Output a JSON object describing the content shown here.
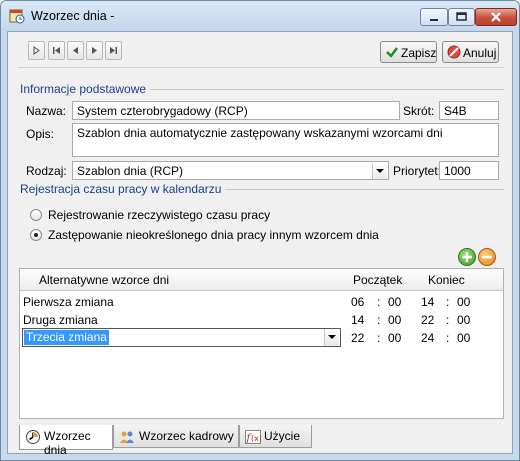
{
  "window": {
    "title": "Wzorzec dnia -"
  },
  "toolbar": {
    "save_label": "Zapisz",
    "cancel_label": "Anuluj"
  },
  "basic": {
    "section_title": "Informacje podstawowe",
    "name_label": "Nazwa:",
    "name_value": "System czterobrygadowy (RCP)",
    "short_label": "Skrót:",
    "short_value": "S4B",
    "desc_label": "Opis:",
    "desc_value": "Szablon dnia automatycznie zastępowany wskazanymi wzorcami dni",
    "type_label": "Rodzaj:",
    "type_value": "Szablon dnia (RCP)",
    "priority_label": "Priorytet:",
    "priority_value": "1000"
  },
  "registration": {
    "section_title": "Rejestracja czasu pracy w kalendarzu",
    "option1": "Rejestrowanie rzeczywistego czasu pracy",
    "option2": "Zastępowanie nieokreślonego dnia pracy innym wzorcem dnia",
    "selected": 2
  },
  "grid": {
    "col_name": "Alternatywne wzorce dni",
    "col_start": "Początek",
    "col_end": "Koniec",
    "rows": [
      {
        "name": "Pierwsza zmiana",
        "sh": "06",
        "sm": "00",
        "eh": "14",
        "em": "00"
      },
      {
        "name": "Druga zmiana",
        "sh": "14",
        "sm": "00",
        "eh": "22",
        "em": "00"
      },
      {
        "name": "Trzecia zmiana",
        "sh": "22",
        "sm": "00",
        "eh": "24",
        "em": "00"
      }
    ],
    "colon": ":"
  },
  "tabs": [
    {
      "label": "Wzorzec dnia"
    },
    {
      "label": "Wzorzec kadrowy"
    },
    {
      "label": "Użycie"
    }
  ],
  "colors": {
    "accent": "#1a3f8f",
    "selection": "#3399ff"
  }
}
